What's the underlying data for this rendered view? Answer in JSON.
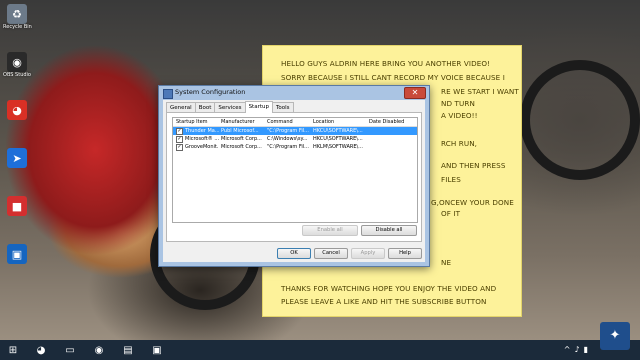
{
  "desktop": {
    "icons": [
      {
        "name": "recycle-bin-icon",
        "label": "Recycle Bin",
        "glyph": "♻",
        "color": "#6c7a89"
      },
      {
        "name": "obs-studio-icon",
        "label": "OBS Studio",
        "glyph": "◉",
        "color": "#2a2a2a"
      },
      {
        "name": "chrome-icon",
        "label": "",
        "glyph": "◕",
        "color": "#d93025"
      },
      {
        "name": "app-blue-icon",
        "label": "",
        "glyph": "➤",
        "color": "#1e6fd9"
      },
      {
        "name": "app-red-icon",
        "label": "",
        "glyph": "■",
        "color": "#d32f2f"
      },
      {
        "name": "film-icon",
        "label": "",
        "glyph": "▣",
        "color": "#1565c0"
      }
    ]
  },
  "sticky": {
    "lines": [
      "HELLO GUYS ALDRIN HERE BRING YOU ANOTHER VIDEO!",
      "SORRY BECAUSE I STILL CANT RECORD MY VOICE BECAUSE I",
      "RE WE START I WANT",
      "ND TURN",
      "A VIDEO!!",
      "RCH RUN,",
      "AND THEN PRESS",
      "FILES",
      "G,ONCEW YOUR DONE",
      "OF IT",
      "NE",
      "THANKS FOR WATCHING HOPE YOU ENJOY THE VIDEO AND",
      "PLEASE LEAVE A LIKE AND HIT THE SUBSCRIBE BUTTON"
    ]
  },
  "window": {
    "title": "System Configuration",
    "tabs": [
      "General",
      "Boot",
      "Services",
      "Startup",
      "Tools"
    ],
    "active_tab": "Startup",
    "columns": [
      "Startup Item",
      "Manufacturer",
      "Command",
      "Location",
      "Date Disabled"
    ],
    "rows": [
      {
        "checked": "✓",
        "item": "Thunder Ma...",
        "manufacturer": "Publ Microsof...",
        "command": "\"C:\\Program Fil...",
        "location": "HKCU\\SOFTWARE\\...",
        "date": ""
      },
      {
        "checked": "✓",
        "item": "Microsoft® ...",
        "manufacturer": "Microsoft Corp...",
        "command": "C:\\Windows\\sy...",
        "location": "HKCU\\SOFTWARE\\...",
        "date": ""
      },
      {
        "checked": "✓",
        "item": "GrooveMonit...",
        "manufacturer": "Microsoft Corp...",
        "command": "\"C:\\Program Fil...",
        "location": "HKLM\\SOFTWARE\\...",
        "date": ""
      }
    ],
    "enable_all": "Enable all",
    "disable_all": "Disable all",
    "ok": "OK",
    "cancel": "Cancel",
    "apply": "Apply",
    "help": "Help"
  },
  "taskbar": {
    "start_glyph": "⊞",
    "items": [
      {
        "name": "taskbar-chrome-icon",
        "glyph": "◕"
      },
      {
        "name": "taskbar-explorer-icon",
        "glyph": "▭"
      },
      {
        "name": "taskbar-obs-icon",
        "glyph": "◉"
      },
      {
        "name": "taskbar-sticky-notes-icon",
        "glyph": "▤"
      },
      {
        "name": "taskbar-msconfig-icon",
        "glyph": "▣"
      }
    ],
    "tray_glyphs": [
      "^",
      "♪",
      "▮"
    ]
  }
}
